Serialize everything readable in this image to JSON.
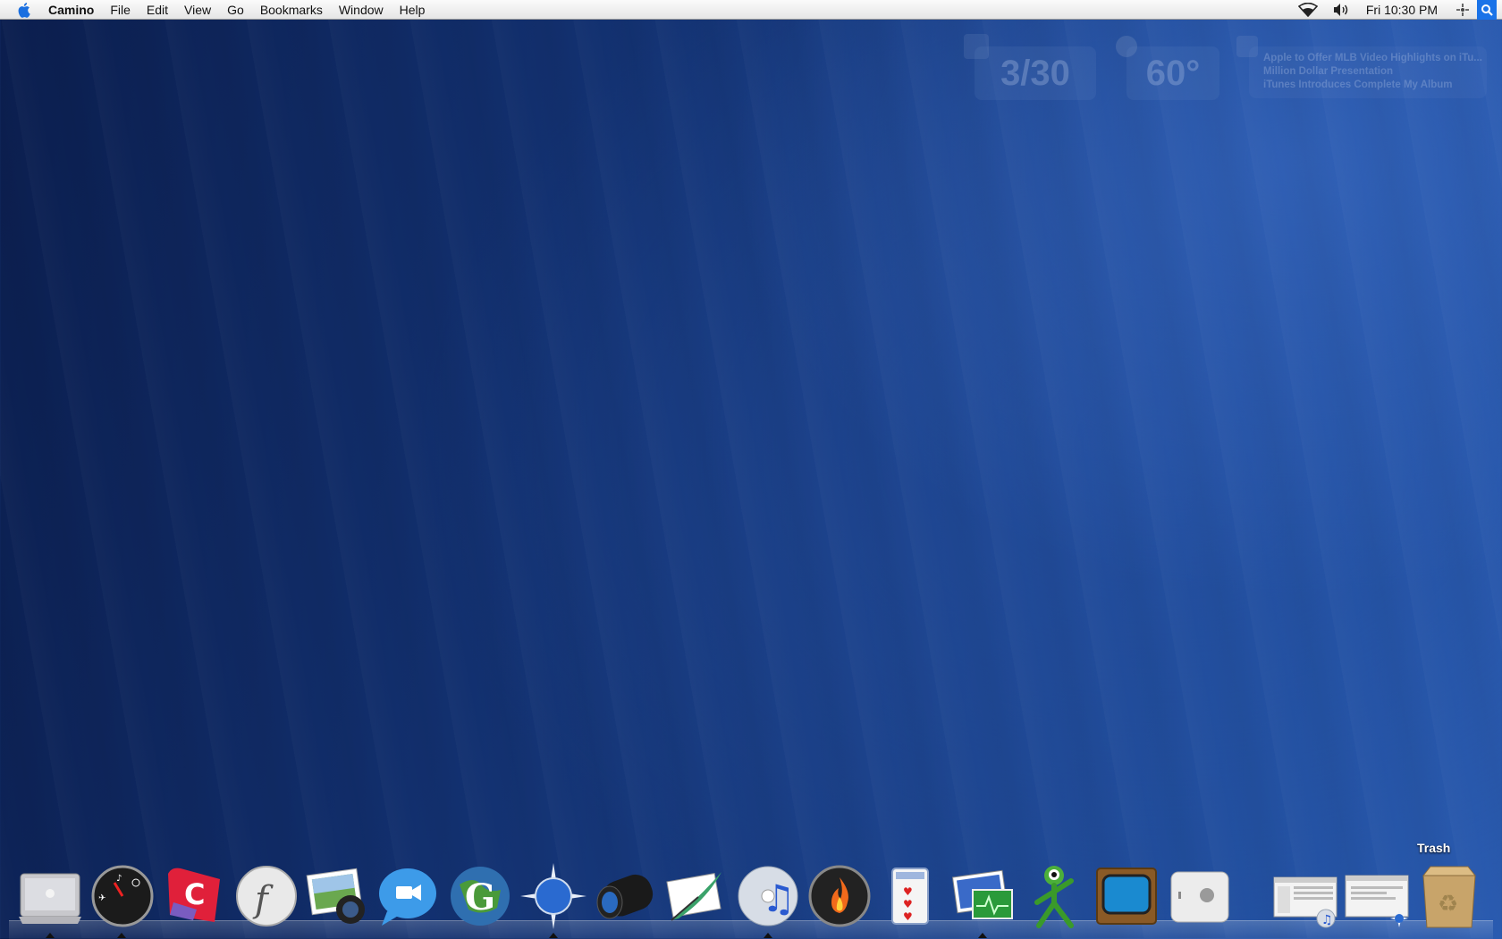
{
  "menubar": {
    "apple_icon": "apple-icon",
    "app_name": "Camino",
    "menus": [
      "File",
      "Edit",
      "View",
      "Go",
      "Bookmarks",
      "Window",
      "Help"
    ],
    "status_icons": [
      "wifi-icon",
      "volume-icon"
    ],
    "clock": "Fri 10:30 PM",
    "extra_icons": [
      "sync-icon",
      "spotlight-icon"
    ]
  },
  "widgets": {
    "calendar_date": "3/30",
    "weather_temp": "60°",
    "rss_headlines": [
      "Apple to Offer MLB Video Highlights on iTu...",
      "Million Dollar Presentation",
      "iTunes Introduces Complete My Album"
    ]
  },
  "dock": {
    "items": [
      "finder-icon",
      "dashboard-icon",
      "camino-icon",
      "fontbook-icon",
      "iphoto-icon",
      "ichat-icon",
      "google-earth-icon",
      "safari-icon",
      "aperture-icon",
      "quill-icon",
      "itunes-icon",
      "firewall-icon",
      "solitaire-icon",
      "activity-monitor-icon",
      "adium-icon",
      "tv-icon",
      "mac-mini-icon",
      "itunes-window-icon",
      "safari-window-icon",
      "trash-icon"
    ],
    "hover_label": "Trash"
  },
  "colors": {
    "desktop_dark": "#0b1e4e",
    "desktop_light": "#2a5bb0",
    "spotlight": "#1a73e8"
  }
}
